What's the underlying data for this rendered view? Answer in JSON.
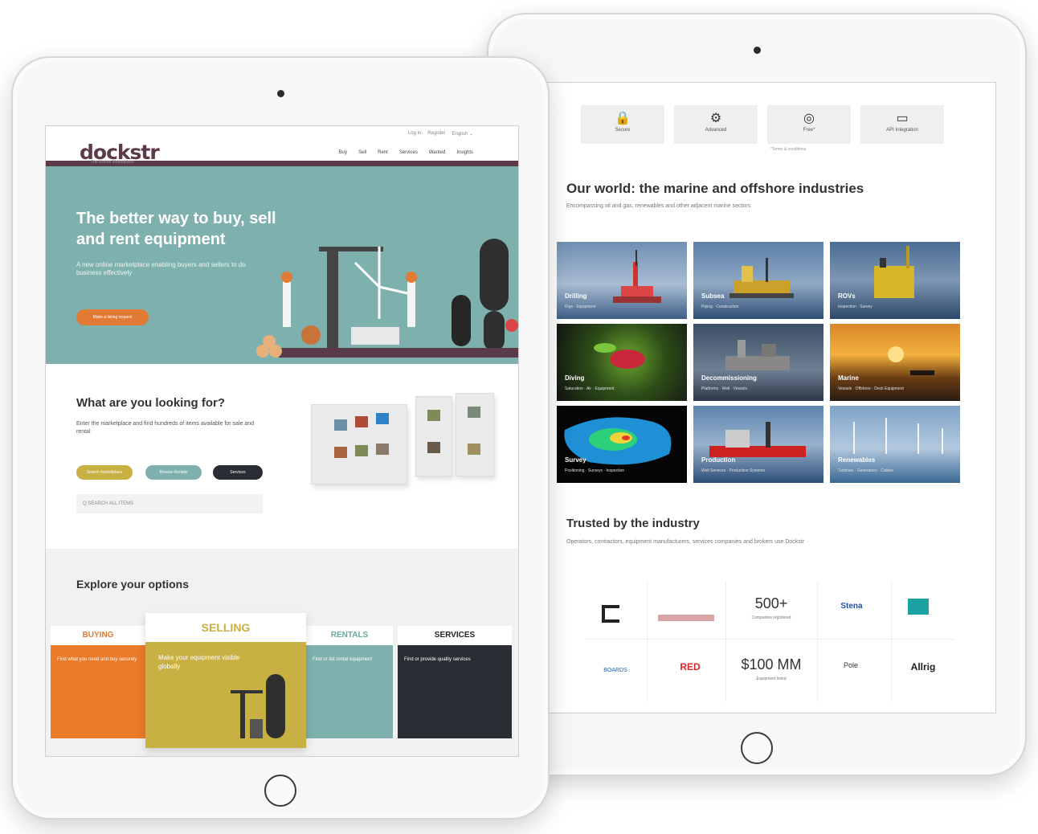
{
  "left_site": {
    "logo": "dockstr",
    "logo_sub": "The Marine Marketplace",
    "util_links": [
      "Log in",
      "Register",
      "English ⌄"
    ],
    "nav": [
      "Buy",
      "Sell",
      "Rent",
      "Services",
      "Wanted",
      "Insights"
    ],
    "hero": {
      "title": "The better way to buy, sell and rent equipment",
      "subtitle": "A new online marketplace enabling buyers and sellers to do business effectively",
      "cta": "Make a listing request"
    },
    "looking": {
      "title": "What are you looking for?",
      "text": "Enter the marketplace and find hundreds of items available for sale and rental",
      "buttons": [
        "Search marketplace",
        "Browse Rentals",
        "Services"
      ],
      "search_placeholder": "Q  SEARCH ALL ITEMS"
    },
    "explore": {
      "title": "Explore your options",
      "cards": [
        {
          "title": "BUYING",
          "text": "Find what you need and buy securely"
        },
        {
          "title": "SELLING",
          "text": "Make your equipment visible globally"
        },
        {
          "title": "RENTALS",
          "text": "Find or list rental equipment"
        },
        {
          "title": "SERVICES",
          "text": "Find or provide quality services"
        }
      ]
    }
  },
  "right_site": {
    "features": [
      {
        "icon": "🔒",
        "label": "Secure"
      },
      {
        "icon": "⚙",
        "label": "Advanced"
      },
      {
        "icon": "◎",
        "label": "Free*"
      },
      {
        "icon": "▭",
        "label": "API Integration"
      }
    ],
    "feature_note": "*Terms & conditions",
    "world": {
      "title": "Our world: the marine and offshore industries",
      "subtitle": "Encompassing oil and gas, renewables and other adjacent marine sectors"
    },
    "tiles": [
      {
        "name": "Drilling",
        "sub": "Rigs · Equipment"
      },
      {
        "name": "Subsea",
        "sub": "Piping · Construction"
      },
      {
        "name": "ROVs",
        "sub": "Inspection · Survey"
      },
      {
        "name": "Diving",
        "sub": "Saturation · Air · Equipment"
      },
      {
        "name": "Decommissioning",
        "sub": "Platforms · Well · Vessels"
      },
      {
        "name": "Marine",
        "sub": "Vessels · Offshore · Deck Equipment"
      },
      {
        "name": "Survey",
        "sub": "Positioning · Surveys · Inspection"
      },
      {
        "name": "Production",
        "sub": "Well Services · Production Systems"
      },
      {
        "name": "Renewables",
        "sub": "Turbines · Generators · Cables"
      }
    ],
    "trusted": {
      "title": "Trusted by the industry",
      "subtitle": "Operators, contractors, equipment manufacturers, services companies and brokers use Dockstr"
    },
    "stats": [
      {
        "value": "500+",
        "label": "Companies registered"
      },
      {
        "value": "$100 MM",
        "label": "Equipment listed"
      }
    ],
    "partner_logos": [
      "Stena",
      "Allrig",
      "RED",
      "BOARDS",
      "Pole"
    ],
    "colors": {
      "accent": "#5b3a4a",
      "hero": "#7eb1ad",
      "cta": "#e07a34"
    }
  }
}
